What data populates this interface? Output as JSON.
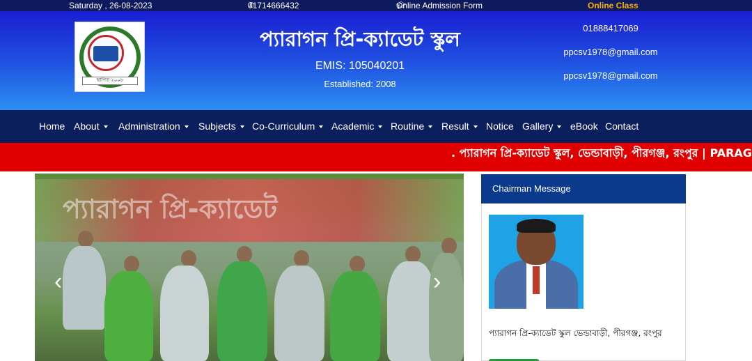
{
  "topbar": {
    "date": "Saturday , 26-08-2023",
    "phone": "01714666432",
    "admission_form": "Online Admission Form",
    "online_class": "Online Class",
    "phone_icon": "phone-icon",
    "form_icon": "graduation-cap-icon"
  },
  "header": {
    "school_name": "প্যারাগন প্রি-ক্যাডেট স্কুল",
    "emis": "EMIS: 105040201",
    "established": "Established: 2008",
    "contact_phone": "01888417069",
    "contact_email_1": "ppcsv1978@gmail.com",
    "contact_email_2": "ppcsv1978@gmail.com",
    "logo_text": "স্থাপিত ২০০৮"
  },
  "nav": {
    "home": "Home",
    "about": "About",
    "administration": "Administration",
    "subjects": "Subjects",
    "co_curriculum": "Co-Curriculum",
    "academic": "Academic",
    "routine": "Routine",
    "result": "Result",
    "notice": "Notice",
    "gallery": "Gallery",
    "ebook": "eBook",
    "contact": "Contact"
  },
  "marquee": {
    "text": ". প্যারাগন প্রি-ক্যাডেট স্কুল, ভেন্ডাবাড়ী, পীরগঞ্জ, রংপুর | PARAGON PRE"
  },
  "carousel": {
    "banner_text": "প্যারাগন প্রি-ক্যাডেট",
    "prev_label": "‹",
    "next_label": "›"
  },
  "chairman": {
    "title": "Chairman Message",
    "caption": "প্যারাগন প্রি-ক্যাডেট স্কুল ভেন্ডাবাড়ী, পীরগঞ্জ, রংপুর"
  },
  "colors": {
    "topbar": "#0d1b5e",
    "header_top": "#1a1fd2",
    "header_bottom": "#2b8ff2",
    "nav": "#0b1f5c",
    "marquee": "#e00000",
    "online_class": "#ffb000",
    "card_header": "#0b3a8c",
    "button": "#1e9e3e"
  }
}
